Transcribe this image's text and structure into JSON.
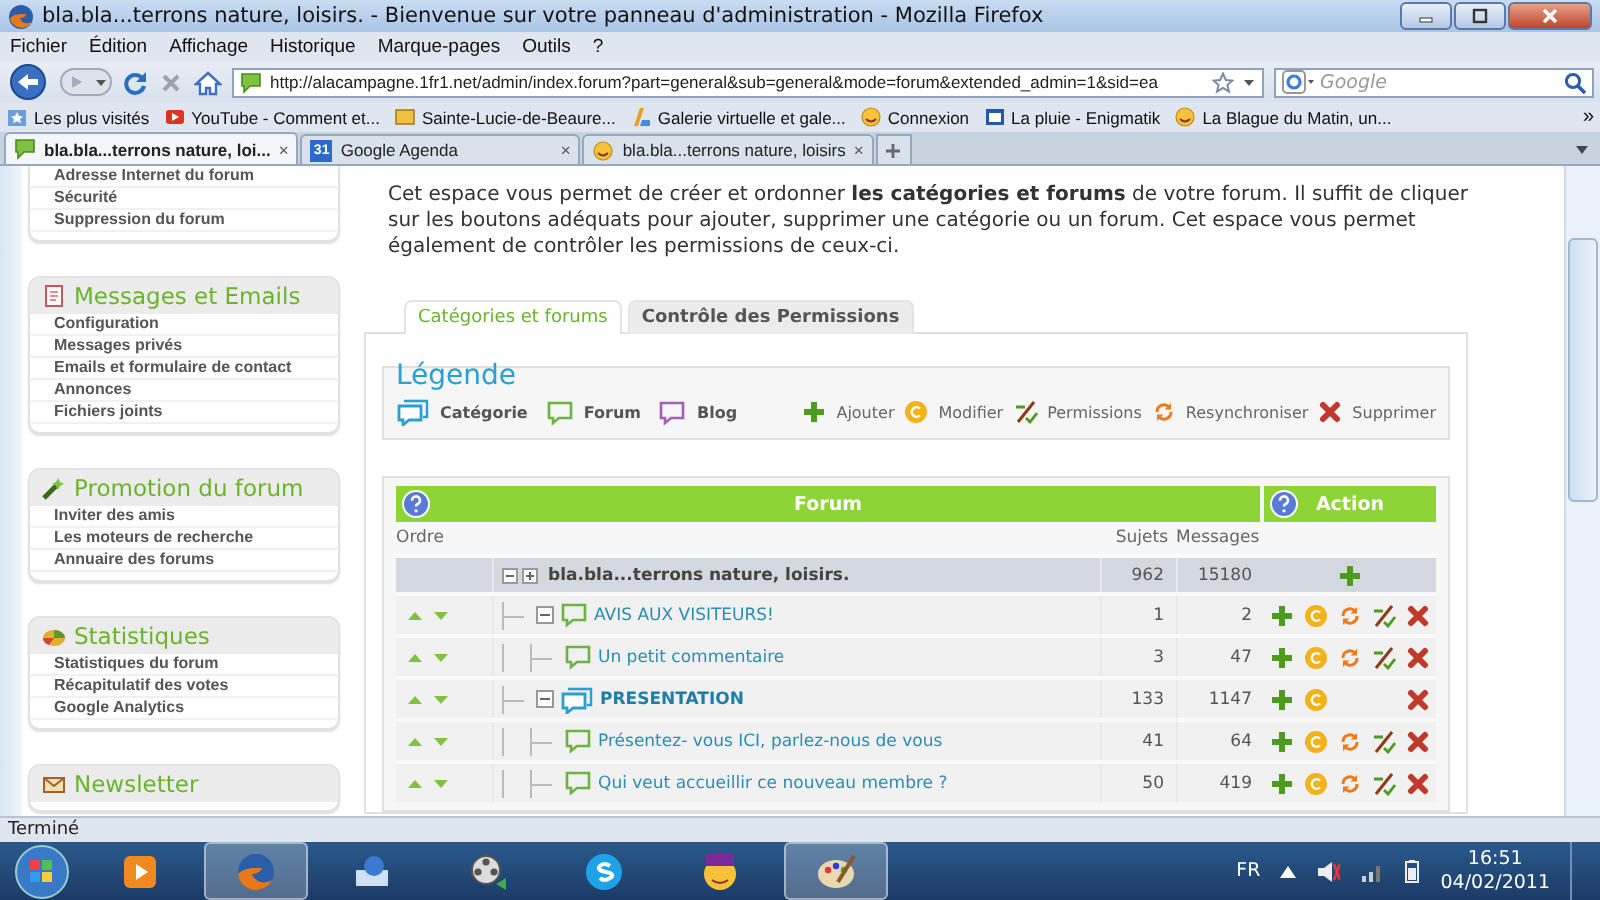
{
  "window": {
    "title": "bla.bla...terrons nature, loisirs. - Bienvenue sur votre panneau d'administration - Mozilla Firefox"
  },
  "menu": [
    "Fichier",
    "Édition",
    "Affichage",
    "Historique",
    "Marque-pages",
    "Outils",
    "?"
  ],
  "navigation": {
    "url": "http://alacampagne.1fr1.net/admin/index.forum?part=general&sub=general&mode=forum&extended_admin=1&sid=ea",
    "search": {
      "placeholder": "Google"
    }
  },
  "bookmarks": {
    "items": [
      {
        "label": "Les plus visités",
        "kind": "star"
      },
      {
        "label": "YouTube - Comment et...",
        "kind": "video"
      },
      {
        "label": "Sainte-Lucie-de-Beaure...",
        "kind": "page"
      },
      {
        "label": "Galerie virtuelle et gale...",
        "kind": "gallery"
      },
      {
        "label": "Connexion",
        "kind": "smiley"
      },
      {
        "label": "La pluie - Enigmatik",
        "kind": "window"
      },
      {
        "label": "La Blague du Matin, un...",
        "kind": "smiley"
      }
    ],
    "overflow": "»"
  },
  "tabs": [
    {
      "label": "bla.bla...terrons nature, loi...",
      "kind": "bubble",
      "selected": true,
      "close": "×"
    },
    {
      "label": "Google Agenda",
      "kind": "calendar",
      "badge": "31",
      "selected": false,
      "close": "×"
    },
    {
      "label": "bla.bla...terrons nature, loisirs",
      "kind": "smiley",
      "selected": false,
      "close": "×"
    }
  ],
  "sidebar": {
    "sections": [
      {
        "kind": "plain",
        "items": [
          "Adresse Internet du forum",
          "Sécurité",
          "Suppression du forum"
        ]
      },
      {
        "kind": "mail",
        "title": "Messages et Emails",
        "items": [
          "Configuration",
          "Messages privés",
          "Emails et formulaire de contact",
          "Annonces",
          "Fichiers joints"
        ]
      },
      {
        "kind": "promo",
        "title": "Promotion du forum",
        "items": [
          "Inviter des amis",
          "Les moteurs de recherche",
          "Annuaire des forums"
        ]
      },
      {
        "kind": "stats",
        "title": "Statistiques",
        "items": [
          "Statistiques du forum",
          "Récapitulatif des votes",
          "Google Analytics"
        ]
      },
      {
        "kind": "newsletter",
        "title": "Newsletter"
      }
    ]
  },
  "main": {
    "intro": "Cet espace vous permet de créer et ordonner **les catégories et forums** de votre forum. Il suffit de cliquer sur les boutons adéquats pour ajouter, supprimer une catégorie ou un forum. Cet espace vous permet également de contrôler les permissions de ceux-ci.",
    "tabs": [
      {
        "label": "Catégories et forums",
        "selected": true
      },
      {
        "label": "Contrôle des Permissions",
        "selected": false
      }
    ],
    "legend": {
      "title": "Légende",
      "types": [
        {
          "label": "Catégorie",
          "kind": "category"
        },
        {
          "label": "Forum",
          "kind": "forum"
        },
        {
          "label": "Blog",
          "kind": "blog"
        }
      ],
      "actions": [
        {
          "label": "Ajouter",
          "kind": "add"
        },
        {
          "label": "Modifier",
          "kind": "edit"
        },
        {
          "label": "Permissions",
          "kind": "permissions"
        },
        {
          "label": "Resynchroniser",
          "kind": "sync"
        },
        {
          "label": "Supprimer",
          "kind": "delete"
        }
      ]
    },
    "table": {
      "header": {
        "forum": "Forum",
        "action": "Action"
      },
      "columns": {
        "order": "Ordre",
        "topics": "Sujets",
        "messages": "Messages"
      },
      "category": {
        "name": "bla.bla...terrons nature, loisirs.",
        "topics": "962",
        "messages": "15180",
        "actions": [
          {
            "kind": "add"
          }
        ]
      },
      "rows": [
        {
          "name": "AVIS AUX VISITEURS!",
          "kind": "forum",
          "topics": "1",
          "messages": "2",
          "expanded": true,
          "actions": [
            {
              "kind": "add"
            },
            {
              "kind": "edit"
            },
            {
              "kind": "sync"
            },
            {
              "kind": "permissions"
            },
            {
              "kind": "delete"
            }
          ],
          "children": [
            {
              "name": "Un petit commentaire",
              "kind": "forum",
              "topics": "3",
              "messages": "47",
              "actions": [
                {
                  "kind": "add"
                },
                {
                  "kind": "edit"
                },
                {
                  "kind": "sync"
                },
                {
                  "kind": "permissions"
                },
                {
                  "kind": "delete"
                }
              ]
            }
          ]
        },
        {
          "name": "PRESENTATION",
          "kind": "category",
          "topics": "133",
          "messages": "1147",
          "expanded": true,
          "actions": [
            {
              "kind": "add"
            },
            {
              "kind": "edit"
            },
            {
              "kind": "delete"
            }
          ],
          "children": [
            {
              "name": "Présentez- vous ICI, parlez-nous de vous",
              "kind": "forum",
              "topics": "41",
              "messages": "64",
              "actions": [
                {
                  "kind": "add"
                },
                {
                  "kind": "edit"
                },
                {
                  "kind": "sync"
                },
                {
                  "kind": "permissions"
                },
                {
                  "kind": "delete"
                }
              ]
            },
            {
              "name": "Qui veut accueillir ce nouveau membre ?",
              "kind": "forum",
              "topics": "50",
              "messages": "419",
              "actions": [
                {
                  "kind": "add"
                },
                {
                  "kind": "edit"
                },
                {
                  "kind": "sync"
                },
                {
                  "kind": "permissions"
                },
                {
                  "kind": "delete"
                }
              ]
            }
          ]
        }
      ]
    }
  },
  "status_bar": {
    "text": "Terminé"
  },
  "taskbar": {
    "apps": [
      {
        "kind": "media",
        "selected": false
      },
      {
        "kind": "firefox",
        "selected": true
      },
      {
        "kind": "mail",
        "selected": false
      },
      {
        "kind": "movie",
        "selected": false
      },
      {
        "kind": "skype",
        "selected": false
      },
      {
        "kind": "messenger",
        "selected": false
      },
      {
        "kind": "paint",
        "selected": true
      }
    ],
    "language": "FR",
    "time": "16:51",
    "date": "04/02/2011"
  }
}
